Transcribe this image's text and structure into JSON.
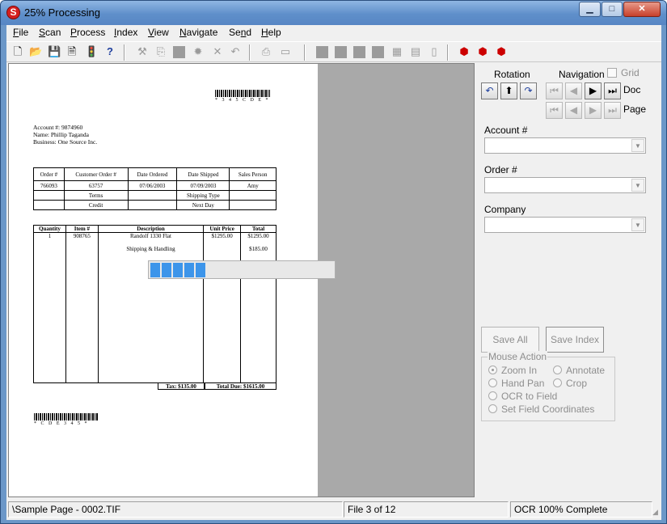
{
  "window": {
    "title": "25% Processing"
  },
  "menu": [
    {
      "label": "File",
      "key": "F",
      "rest": "ile"
    },
    {
      "label": "Scan",
      "key": "S",
      "rest": "can"
    },
    {
      "label": "Process",
      "key": "P",
      "rest": "rocess"
    },
    {
      "label": "Index",
      "key": "I",
      "rest": "ndex"
    },
    {
      "label": "View",
      "key": "V",
      "rest": "iew"
    },
    {
      "label": "Navigate",
      "key": "N",
      "rest": "avigate"
    },
    {
      "label": "Send",
      "key": "S",
      "pre": "",
      "rest": "end"
    },
    {
      "label": "Help",
      "key": "H",
      "rest": "elp"
    }
  ],
  "document": {
    "barcode_top": "* 3 4 5 C D E *",
    "barcode_bottom": "* C D E 3 4 5 *",
    "account_line": "Account #:  9874960",
    "name_line": "Name:  Phillip Taganda",
    "business_line": "Business:  One Source Inc.",
    "header_table": {
      "columns": [
        "Order #",
        "Customer Order #",
        "Date Ordered",
        "Date Shipped",
        "Sales Person"
      ],
      "row": [
        "766093",
        "63757",
        "07/06/2003",
        "07/09/2003",
        "Amy"
      ],
      "terms_label": "Terms",
      "terms_value": "Credit",
      "shipping_label": "Shipping Type",
      "shipping_value": "Next Day"
    },
    "items_table": {
      "columns": [
        "Quantity",
        "Item #",
        "Description",
        "Unit Price",
        "Total"
      ],
      "rows": [
        {
          "qty": "1",
          "item": "908765",
          "desc": "Randolf 1330 Flat",
          "unit": "$1295.00",
          "total": "$1295.00"
        },
        {
          "qty": "",
          "item": "",
          "desc": "Shipping & Handling",
          "unit": "",
          "total": "$185.00"
        }
      ],
      "tax": "Tax:  $135.00",
      "total_due": "Total Due:  $1615.00"
    },
    "progress_fraction": 0.25
  },
  "panel": {
    "rotation_label": "Rotation",
    "navigation_label": "Navigation",
    "grid_label": "Grid",
    "doc_label": "Doc",
    "page_label": "Page",
    "account_label": "Account #",
    "order_label": "Order #",
    "company_label": "Company",
    "account_value": "",
    "order_value": "",
    "company_value": "",
    "save_all_label": "Save All",
    "save_index_label": "Save Index",
    "mouse_action_label": "Mouse Action",
    "radio_zoom_in": "Zoom In",
    "radio_annotate": "Annotate",
    "radio_hand_pan": "Hand Pan",
    "radio_crop": "Crop",
    "radio_ocr": "OCR to Field",
    "radio_set_coords": "Set Field Coordinates"
  },
  "status": {
    "file_path": "\\Sample Page - 0002.TIF",
    "file_count": "File 3 of 12",
    "ocr_status": "OCR 100% Complete"
  },
  "colors": {
    "accent_progress": "#3d95ea",
    "close_button": "#c7402b"
  }
}
